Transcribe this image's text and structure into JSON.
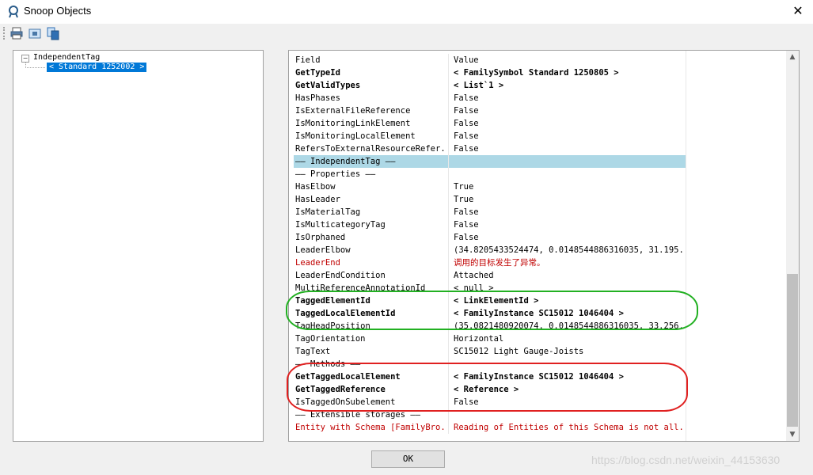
{
  "window": {
    "title": "Snoop Objects",
    "close_glyph": "✕"
  },
  "toolbar": {
    "icons": [
      "print-icon",
      "snoop-icon",
      "copy-icon"
    ]
  },
  "tree": {
    "root_label": "IndependentTag",
    "child_label": "< Standard  1252002 >"
  },
  "grid": {
    "header": {
      "field": "Field",
      "value": "Value"
    },
    "rows": [
      {
        "field": "GetTypeId",
        "value": "< FamilySymbol  Standard  1250805 >",
        "style": "bold"
      },
      {
        "field": "GetValidTypes",
        "value": "< List`1 >",
        "style": "bold"
      },
      {
        "field": "HasPhases",
        "value": "False",
        "style": ""
      },
      {
        "field": "IsExternalFileReference",
        "value": "False",
        "style": ""
      },
      {
        "field": "IsMonitoringLinkElement",
        "value": "False",
        "style": ""
      },
      {
        "field": "IsMonitoringLocalElement",
        "value": "False",
        "style": ""
      },
      {
        "field": "RefersToExternalResourceRefer...",
        "value": "False",
        "style": ""
      },
      {
        "field": "—— IndependentTag ——",
        "value": "",
        "style": "sel"
      },
      {
        "field": "  —— Properties ——",
        "value": "",
        "style": ""
      },
      {
        "field": "HasElbow",
        "value": "True",
        "style": ""
      },
      {
        "field": "HasLeader",
        "value": "True",
        "style": ""
      },
      {
        "field": "IsMaterialTag",
        "value": "False",
        "style": ""
      },
      {
        "field": "IsMulticategoryTag",
        "value": "False",
        "style": ""
      },
      {
        "field": "IsOrphaned",
        "value": "False",
        "style": ""
      },
      {
        "field": "LeaderElbow",
        "value": "(34.8205433524474, 0.0148544886316035, 31.195...",
        "style": ""
      },
      {
        "field": "LeaderEnd",
        "value": "调用的目标发生了异常。",
        "style": "err"
      },
      {
        "field": "LeaderEndCondition",
        "value": "Attached",
        "style": ""
      },
      {
        "field": "MultiReferenceAnnotationId",
        "value": "< null >",
        "style": ""
      },
      {
        "field": "TaggedElementId",
        "value": "< LinkElementId >",
        "style": "bold"
      },
      {
        "field": "TaggedLocalElementId",
        "value": "< FamilyInstance  SC15012  1046404 >",
        "style": "bold"
      },
      {
        "field": "TagHeadPosition",
        "value": "(35.0821480920074, 0.0148544886316035, 33.256...",
        "style": ""
      },
      {
        "field": "TagOrientation",
        "value": "Horizontal",
        "style": ""
      },
      {
        "field": "TagText",
        "value": "SC15012 Light Gauge-Joists",
        "style": ""
      },
      {
        "field": "  —— Methods ——",
        "value": "",
        "style": ""
      },
      {
        "field": "GetTaggedLocalElement",
        "value": "< FamilyInstance  SC15012  1046404 >",
        "style": "bold"
      },
      {
        "field": "GetTaggedReference",
        "value": "< Reference >",
        "style": "bold"
      },
      {
        "field": "IsTaggedOnSubelement",
        "value": "False",
        "style": ""
      },
      {
        "field": "—— Extensible storages ——",
        "value": "",
        "style": ""
      },
      {
        "field": "Entity with Schema [FamilyBro...",
        "value": "Reading of Entities of this Schema is not all...",
        "style": "err"
      }
    ]
  },
  "buttons": {
    "ok_label": "OK"
  },
  "watermark": "https://blog.csdn.net/weixin_44153630",
  "colors": {
    "selection": "#0078d7",
    "row_highlight": "#add8e6",
    "error_text": "#c00000",
    "green_annotation": "#22b022",
    "red_annotation": "#e02020"
  }
}
